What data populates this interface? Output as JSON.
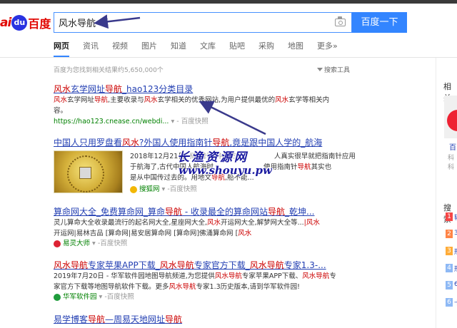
{
  "logo": {
    "ai": "ai",
    "du": "du",
    "cn": "百度"
  },
  "search": {
    "query": "风水导航",
    "button": "百度一下"
  },
  "tabs": [
    "网页",
    "资讯",
    "视频",
    "图片",
    "知道",
    "文库",
    "贴吧",
    "采购",
    "地图",
    "更多»"
  ],
  "stats": "百度为您找到相关结果约5,650,000个",
  "tools": "搜索工具",
  "watermark": {
    "line1": "长渔资源网",
    "line2": "www.shouyu.pw"
  },
  "right_panel": {
    "heading": "相关",
    "image_label": "百",
    "image_sub": "科科",
    "heading2": "搜索",
    "ranks": [
      {
        "num": "1",
        "text": "转",
        "color": "#f54545"
      },
      {
        "num": "2",
        "text": "3",
        "color": "#ff8547"
      },
      {
        "num": "3",
        "text": "形",
        "color": "#ffac38"
      },
      {
        "num": "4",
        "text": "形",
        "color": "#8eb9f5"
      },
      {
        "num": "5",
        "text": "6",
        "color": "#8eb9f5"
      },
      {
        "num": "6",
        "text": "卡",
        "color": "#8eb9f5"
      }
    ]
  },
  "results": [
    {
      "title": [
        {
          "t": "风水",
          "em": true
        },
        {
          "t": "玄学网址",
          "em": false
        },
        {
          "t": "导航",
          "em": true
        },
        {
          "t": "_hao123分类目录",
          "em": false
        }
      ],
      "abstract": [
        [
          {
            "t": "风水",
            "em": true
          },
          {
            "t": "玄学网址",
            "em": false
          },
          {
            "t": "导航",
            "em": true
          },
          {
            "t": ",主要收录与",
            "em": false
          },
          {
            "t": "风水",
            "em": true
          },
          {
            "t": "玄学相关的优秀网站,为用户提供最优的",
            "em": false
          },
          {
            "t": "风水",
            "em": true
          },
          {
            "t": "玄学等相关内",
            "em": false
          }
        ],
        [
          {
            "t": "容。",
            "em": false
          }
        ]
      ],
      "url": "https://hao123.cnease.cn/webdi...",
      "snapshot": "百度快照"
    },
    {
      "title": [
        {
          "t": "中国人只用罗盘看",
          "em": false
        },
        {
          "t": "风水",
          "em": true
        },
        {
          "t": "?外国人使用指南针",
          "em": false
        },
        {
          "t": "导航",
          "em": true
        },
        {
          "t": ",竟是跟中国人学的_航海",
          "em": false
        }
      ],
      "date": "2018年12月21日",
      "abstract": [
        [
          {
            "t": "2018年12月21日 ",
            "em": false
          },
          {
            "t": "-指南针是中国古代人最",
            "em": false
          },
          {
            "t": "",
            "em": false
          },
          {
            "t": "...",
            "em": false
          },
          {
            "t": "人真实很早就把指南针应用",
            "em": false
          }
        ],
        [
          {
            "t": "于航海了,古代中国人航海时  ...有时候",
            "em": false
          },
          {
            "t": "",
            "em": false
          },
          {
            "t": "...",
            "em": false
          },
          {
            "t": "使用指南针",
            "em": false
          },
          {
            "t": "导航",
            "em": true
          },
          {
            "t": "其实也",
            "em": false
          }
        ],
        [
          {
            "t": "是从中国传过去的。用地文",
            "em": false
          },
          {
            "t": "导航",
            "em": true
          },
          {
            "t": ",船不能...",
            "em": false
          }
        ]
      ],
      "source": "搜狐网",
      "snapshot": "百度快照"
    },
    {
      "title": [
        {
          "t": "算命网大全_免费算命网_算命",
          "em": false
        },
        {
          "t": "导航",
          "em": true
        },
        {
          "t": " - 收录最全的算命网站",
          "em": false
        },
        {
          "t": "导航",
          "em": true
        },
        {
          "t": "_乾坤...",
          "em": false
        }
      ],
      "abstract": [
        [
          {
            "t": "灵儿算命大全收录最流行的起名网大全,星座网大全,",
            "em": false
          },
          {
            "t": "风水",
            "em": true
          },
          {
            "t": "开运网大全,解梦网大全等...",
            "em": false
          },
          {
            "t": "|风水",
            "em": true
          }
        ],
        [
          {
            "t": "开运网|易林吉品 [算命网|易安居算命网 [算命网]佛涌算命网 [",
            "em": false
          },
          {
            "t": "风水",
            "em": true
          }
        ]
      ],
      "source": "易灵大师",
      "snapshot": "百度快照"
    },
    {
      "title": [
        {
          "t": "风水",
          "em": true
        },
        {
          "t": "导航",
          "em": true
        },
        {
          "t": "专家苹果APP下载_",
          "em": false
        },
        {
          "t": "风水",
          "em": true
        },
        {
          "t": "导航",
          "em": true
        },
        {
          "t": "专家官方下载_",
          "em": false
        },
        {
          "t": "风水",
          "em": true
        },
        {
          "t": "导航",
          "em": true
        },
        {
          "t": "专家1.3-...",
          "em": false
        }
      ],
      "abstract": [
        [
          {
            "t": "2019年7月20日 - 华军软件园地图导航频道,为您提供",
            "em": false
          },
          {
            "t": "风水导航",
            "em": true
          },
          {
            "t": "专家苹果APP下载、",
            "em": false
          },
          {
            "t": "风水导航",
            "em": true
          },
          {
            "t": "专",
            "em": false
          }
        ],
        [
          {
            "t": "家官方下载等地图导航软件下载。更多",
            "em": false
          },
          {
            "t": "风水导航",
            "em": true
          },
          {
            "t": "专家1.3历史版本,请到华军软件园!",
            "em": false
          }
        ]
      ],
      "source": "华军软件园",
      "snapshot": "百度快照"
    },
    {
      "title": [
        {
          "t": "易学博客",
          "em": false
        },
        {
          "t": "导航",
          "em": true
        },
        {
          "t": "—周易天地网址",
          "em": false
        },
        {
          "t": "导航",
          "em": true
        }
      ]
    }
  ]
}
